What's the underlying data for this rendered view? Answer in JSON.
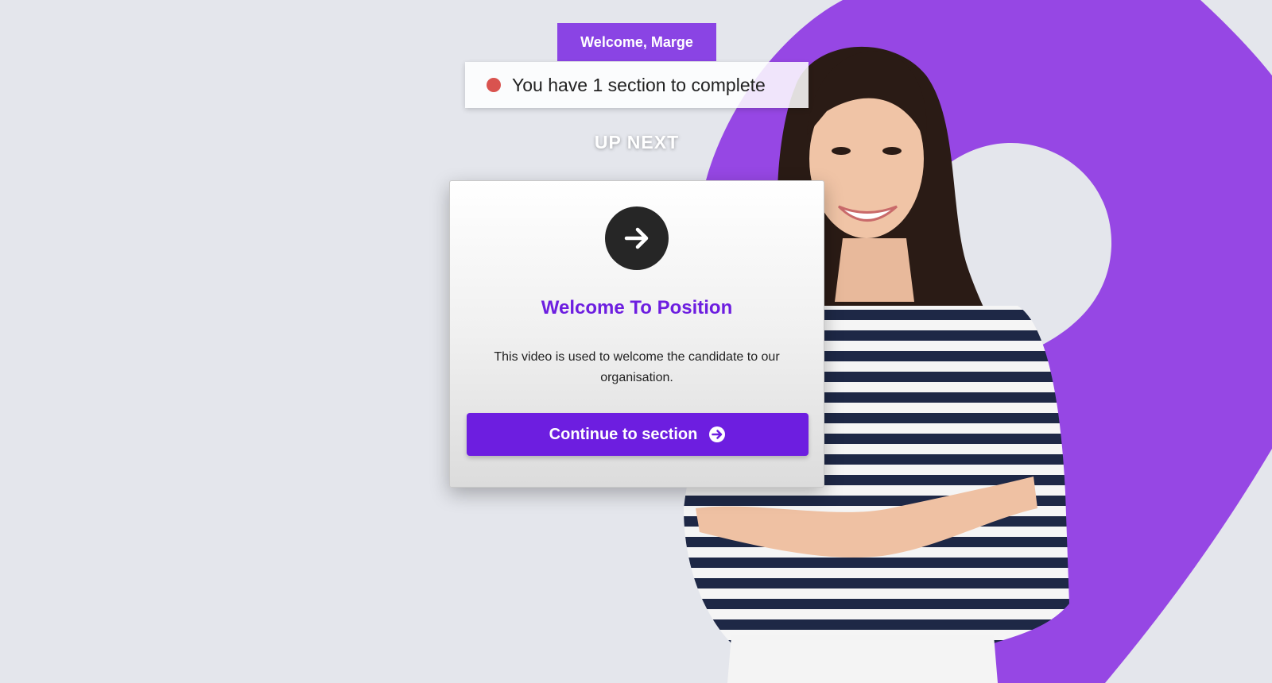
{
  "header": {
    "greeting": "Welcome, Marge",
    "status_text": "You have 1 section to complete",
    "up_next": "UP NEXT"
  },
  "card": {
    "icon": "arrow-right-icon",
    "title": "Welcome To Position",
    "description": "This video is used to welcome the candidate to our organisation.",
    "button_label": "Continue to section",
    "button_icon": "arrow-circle-right-icon"
  },
  "colors": {
    "brand_purple": "#8a44e4",
    "accent_purple": "#6d1ee0",
    "status_red": "#d9534f",
    "background": "#e4e6ec"
  }
}
